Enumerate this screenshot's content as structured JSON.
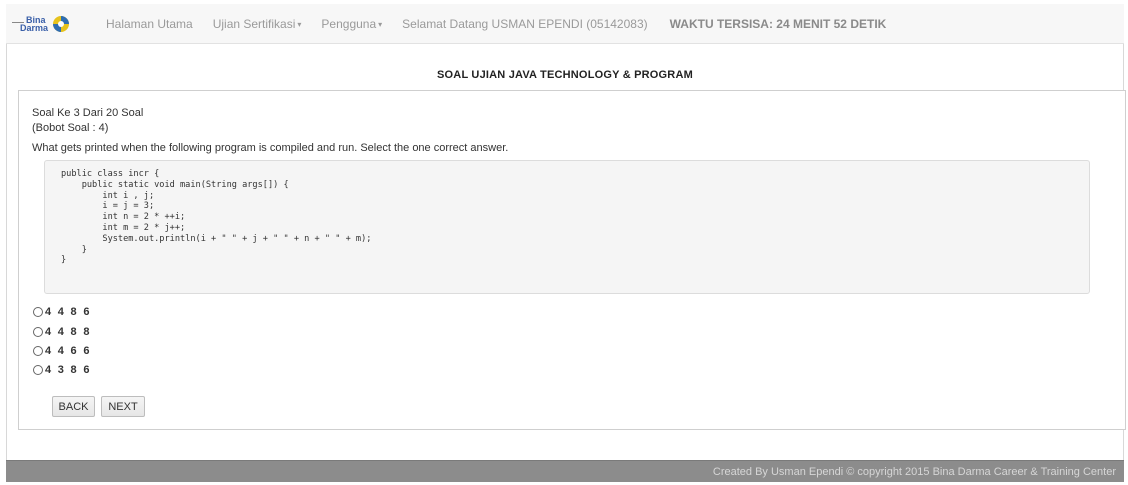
{
  "navbar": {
    "brand_line1": "Bina",
    "brand_line2": "Darma",
    "items": [
      {
        "label": "Halaman Utama"
      },
      {
        "label": "Ujian Sertifikasi",
        "caret": "▾"
      },
      {
        "label": "Pengguna",
        "caret": "▾"
      },
      {
        "label": "Selamat Datang USMAN EPENDI (05142083)"
      }
    ],
    "timer": "WAKTU TERSISA: 24 MENIT 52 DETIK"
  },
  "exam": {
    "title": "SOAL UJIAN JAVA TECHNOLOGY & PROGRAM"
  },
  "question": {
    "number_text": "Soal Ke 3 Dari 20 Soal",
    "weight_text": "(Bobot Soal : 4)",
    "prompt": "What gets printed when the following program is compiled and run. Select the one correct answer.",
    "code": "public class incr {\n    public static void main(String args[]) {\n        int i , j;\n        i = j = 3;\n        int n = 2 * ++i;\n        int m = 2 * j++;\n        System.out.println(i + \" \" + j + \" \" + n + \" \" + m);\n    }\n}",
    "options": [
      {
        "label": "4 4 8 6",
        "selected": false
      },
      {
        "label": "4 4 8 8",
        "selected": false
      },
      {
        "label": "4 4 6 6",
        "selected": false
      },
      {
        "label": "4 3 8 6",
        "selected": false
      }
    ]
  },
  "buttons": {
    "back": "BACK",
    "next": "NEXT"
  },
  "footer": {
    "text": "Created By Usman Ependi © copyright 2015 Bina Darma Career & Training Center"
  }
}
